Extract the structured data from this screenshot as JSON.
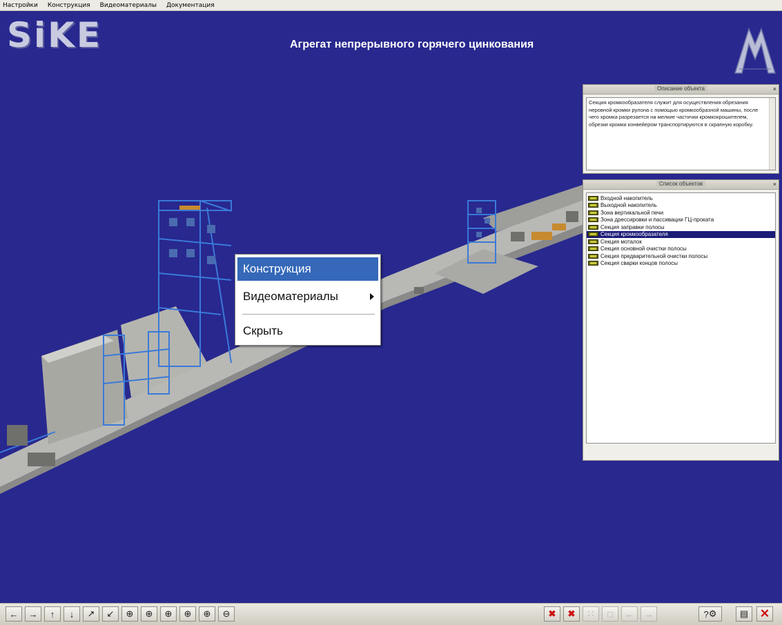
{
  "menu": [
    "Настройки",
    "Конструкция",
    "Видеоматериалы",
    "Документация"
  ],
  "header": {
    "logo_left": "SiKE",
    "title": "Агрегат непрерывного горячего цинкования"
  },
  "desc_panel": {
    "title": "Описание объекта",
    "close": "×",
    "text": "Секция кромкообразателя служит для осуществления обрезания неровной кромки рулона с помощью кромкообразной машины, после чего кромка разрезается на мелкие частички кромкокрошителем, обрезки кромки конвейером транспортируются в скрапную коробку."
  },
  "list_panel": {
    "title": "Список объектов",
    "close": "×",
    "items": [
      {
        "label": "Входной накопитель",
        "selected": false
      },
      {
        "label": "Выходной накопитель",
        "selected": false
      },
      {
        "label": "Зона вертикальной печи",
        "selected": false
      },
      {
        "label": "Зона дрессировки и пассивации ГЦ-проката",
        "selected": false
      },
      {
        "label": "Секция заправки полосы",
        "selected": false
      },
      {
        "label": "Секция кромкообразателя",
        "selected": true
      },
      {
        "label": "Секция моталок",
        "selected": false
      },
      {
        "label": "Секция основной очистки полосы",
        "selected": false
      },
      {
        "label": "Секция предварительной очистки полосы",
        "selected": false
      },
      {
        "label": "Секция сварки концов полосы",
        "selected": false
      }
    ]
  },
  "context_menu": {
    "items": [
      "Конструкция",
      "Видеоматериалы",
      "Скрыть"
    ]
  },
  "toolbar": {
    "left_buttons": [
      "pan-left-icon",
      "pan-right-icon",
      "pan-up-icon",
      "pan-down-icon",
      "tilt-left-icon",
      "tilt-right-icon",
      "rotate-y-icon",
      "rotate-y2-icon",
      "rotate-x-icon",
      "rotate-x2-icon",
      "zoom-in-icon",
      "zoom-out-icon"
    ],
    "right_buttons": [
      "marker-icon",
      "markers-icon",
      "grid-icon",
      "dock-icon",
      "arrow-left-icon",
      "arrow-right-icon",
      "help-icon",
      "document-icon",
      "close-icon"
    ],
    "help_label": "?"
  },
  "colors": {
    "background": "#28288f",
    "selection": "#1b1b78",
    "menu_highlight": "#3568b8"
  }
}
